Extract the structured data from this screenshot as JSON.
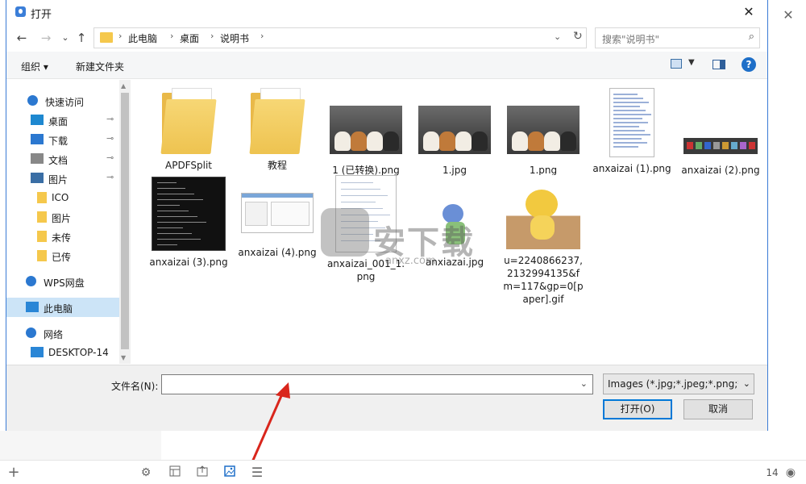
{
  "dialog": {
    "title": "打开",
    "close_glyph": "✕"
  },
  "nav": {
    "back_glyph": "←",
    "forward_glyph": "→",
    "recent_glyph": "⌄",
    "up_glyph": "↑",
    "breadcrumb": [
      "此电脑",
      "桌面",
      "说明书"
    ],
    "sep_glyph": "›",
    "dropdown_glyph": "⌄",
    "refresh_glyph": "↻",
    "search_placeholder": "搜索\"说明书\"",
    "search_glyph": "⌕"
  },
  "toolbar": {
    "organize_label": "组织 ▾",
    "new_folder_label": "新建文件夹",
    "view_caret": "▼",
    "help_label": "?"
  },
  "sidebar": {
    "items": [
      {
        "label": "快速访问",
        "icon": "star-icon",
        "pinned": false
      },
      {
        "label": "桌面",
        "icon": "desktop-icon",
        "pinned": true
      },
      {
        "label": "下载",
        "icon": "download-icon",
        "pinned": true
      },
      {
        "label": "文档",
        "icon": "document-icon",
        "pinned": true
      },
      {
        "label": "图片",
        "icon": "picture-icon",
        "pinned": true
      },
      {
        "label": "ICO",
        "icon": "folder-icon",
        "pinned": false
      },
      {
        "label": "图片",
        "icon": "folder-icon",
        "pinned": false
      },
      {
        "label": "未传",
        "icon": "folder-icon",
        "pinned": false
      },
      {
        "label": "已传",
        "icon": "folder-icon",
        "pinned": false
      },
      {
        "label": "WPS网盘",
        "icon": "cloud-icon",
        "pinned": false
      },
      {
        "label": "此电脑",
        "icon": "computer-icon",
        "pinned": false,
        "selected": true
      },
      {
        "label": "网络",
        "icon": "network-icon",
        "pinned": false
      },
      {
        "label": "DESKTOP-14",
        "icon": "computer-icon",
        "pinned": false
      }
    ],
    "pin_glyph": "📌"
  },
  "files": [
    {
      "name": "APDFSplit",
      "kind": "folder"
    },
    {
      "name": "教程",
      "kind": "folder"
    },
    {
      "name": "1 (已转换).png",
      "kind": "dogs"
    },
    {
      "name": "1.jpg",
      "kind": "dogs"
    },
    {
      "name": "1.png",
      "kind": "dogs"
    },
    {
      "name": "anxaizai (1).png",
      "kind": "menu-screenshot"
    },
    {
      "name": "anxaizai (2).png",
      "kind": "toolbar-screenshot"
    },
    {
      "name": "anxaizai (3).png",
      "kind": "dark-screenshot"
    },
    {
      "name": "anxaizai (4).png",
      "kind": "window-screenshot"
    },
    {
      "name": "anxaizai_001_1.png",
      "kind": "doc-screenshot"
    },
    {
      "name": "anxiazai.jpg",
      "kind": "anime"
    },
    {
      "name": "u=2240866237,2132994135&fm=117&gp=0[paper].gif",
      "kind": "cat"
    }
  ],
  "bottom": {
    "filename_label": "文件名(N):",
    "filename_value": "",
    "filename_dd": "⌄",
    "filter_label": "Images (*.jpg;*.jpeg;*.png;*.g",
    "filter_dd": "⌄",
    "open_label": "打开(O)",
    "cancel_label": "取消"
  },
  "watermark": {
    "text": "安下载",
    "sub": "anxz.com"
  },
  "statusbar": {
    "add_glyph": "+",
    "settings_glyph": "⚙",
    "count": "14",
    "eye_glyph": "◉"
  },
  "colors": {
    "accent": "#0078d7",
    "folder": "#f5c84c",
    "selected": "#cce4f7",
    "arrow": "#d9261c"
  }
}
